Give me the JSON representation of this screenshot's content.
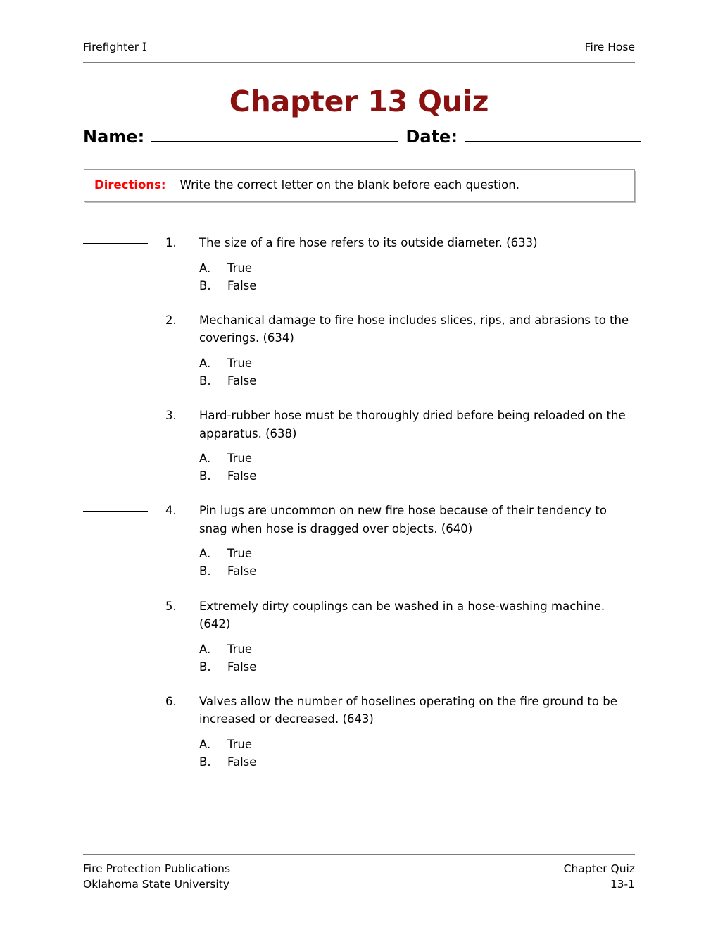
{
  "header": {
    "left": "Firefighter I",
    "right": "Fire Hose"
  },
  "title": "Chapter 13 Quiz",
  "title_color": "#8B1111",
  "name_date": {
    "name_label": "Name:",
    "date_label": "Date:"
  },
  "directions": {
    "label": "Directions:",
    "label_color": "#FF0000",
    "text": "Write the correct letter on the blank before each question."
  },
  "questions": [
    {
      "number": "1.",
      "text": "The size of a fire hose refers to its outside diameter. (633)",
      "options": [
        {
          "letter": "A.",
          "text": "True"
        },
        {
          "letter": "B.",
          "text": "False"
        }
      ]
    },
    {
      "number": "2.",
      "text": "Mechanical damage to fire hose includes slices, rips, and abrasions to the coverings. (634)",
      "options": [
        {
          "letter": "A.",
          "text": "True"
        },
        {
          "letter": "B.",
          "text": "False"
        }
      ]
    },
    {
      "number": "3.",
      "text": "Hard-rubber hose must be thoroughly dried before being reloaded on the apparatus. (638)",
      "options": [
        {
          "letter": "A.",
          "text": "True"
        },
        {
          "letter": "B.",
          "text": "False"
        }
      ]
    },
    {
      "number": "4.",
      "text": "Pin lugs are uncommon on new fire hose because of their tendency to snag when hose is dragged over objects. (640)",
      "options": [
        {
          "letter": "A.",
          "text": "True"
        },
        {
          "letter": "B.",
          "text": "False"
        }
      ]
    },
    {
      "number": "5.",
      "text": "Extremely dirty couplings can be washed in a hose-washing machine. (642)",
      "options": [
        {
          "letter": "A.",
          "text": "True"
        },
        {
          "letter": "B.",
          "text": "False"
        }
      ]
    },
    {
      "number": "6.",
      "text": "Valves allow the number of hoselines operating on the fire ground to be increased or decreased. (643)",
      "options": [
        {
          "letter": "A.",
          "text": "True"
        },
        {
          "letter": "B.",
          "text": "False"
        }
      ]
    }
  ],
  "footer": {
    "left_line1": "Fire Protection Publications",
    "left_line2": "Oklahoma State University",
    "right_line1": "Chapter Quiz",
    "right_line2": "13-1"
  }
}
